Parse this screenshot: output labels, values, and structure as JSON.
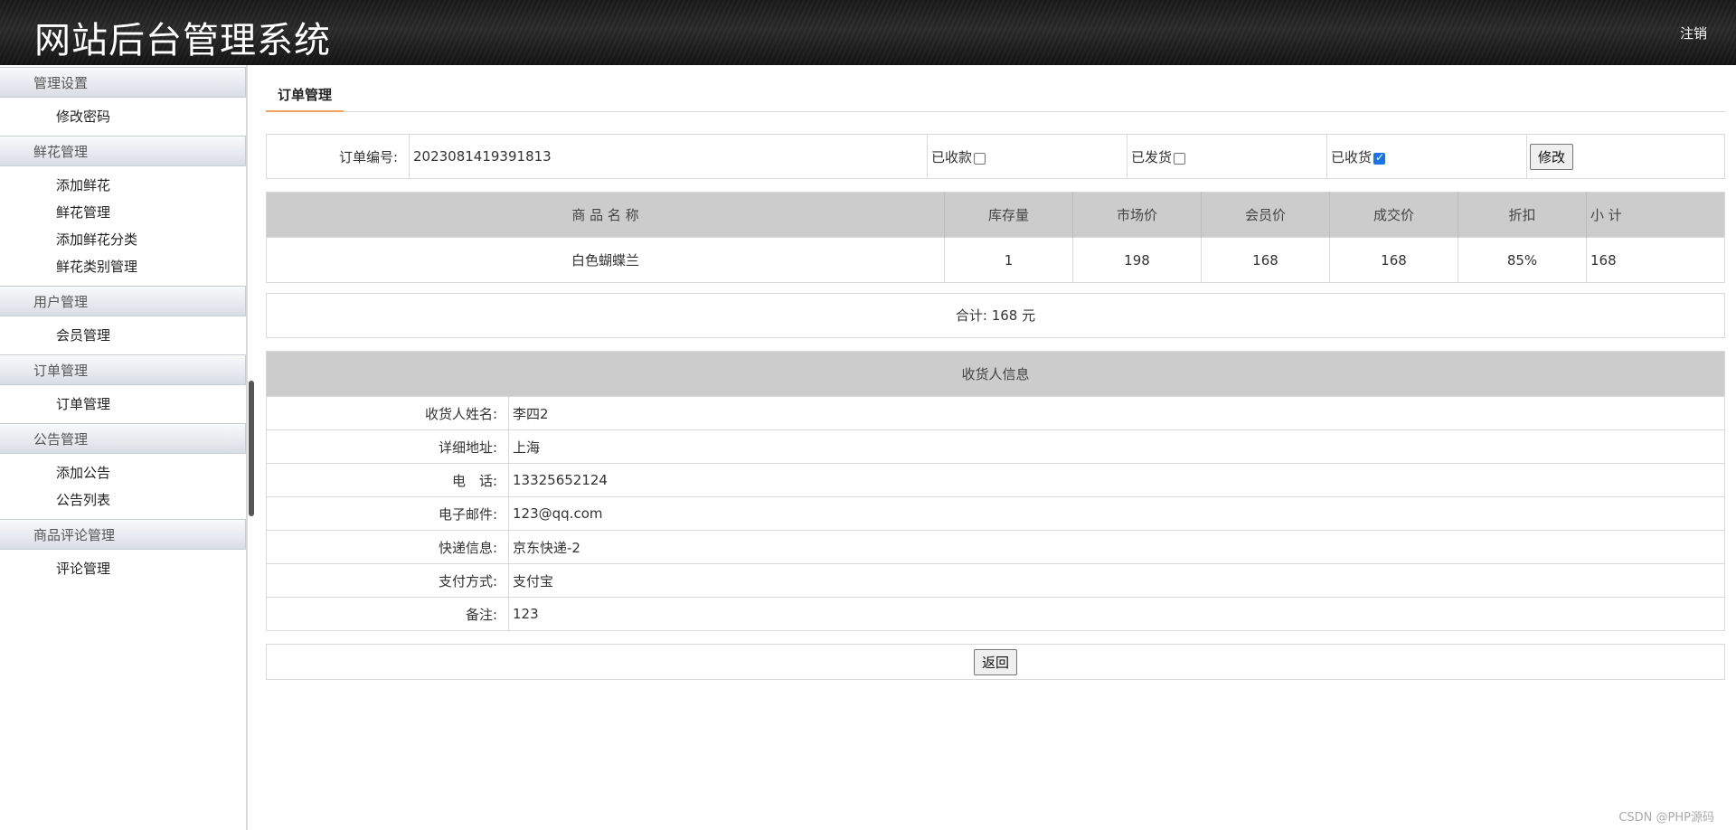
{
  "header": {
    "title": "网站后台管理系统",
    "logout_label": "注销"
  },
  "sidebar": {
    "groups": [
      {
        "label": "管理设置",
        "items": [
          "修改密码"
        ]
      },
      {
        "label": "鲜花管理",
        "items": [
          "添加鲜花",
          "鲜花管理",
          "添加鲜花分类",
          "鲜花类别管理"
        ]
      },
      {
        "label": "用户管理",
        "items": [
          "会员管理"
        ]
      },
      {
        "label": "订单管理",
        "items": [
          "订单管理"
        ]
      },
      {
        "label": "公告管理",
        "items": [
          "添加公告",
          "公告列表"
        ]
      },
      {
        "label": "商品评论管理",
        "items": [
          "评论管理"
        ]
      }
    ]
  },
  "tab": {
    "label": "订单管理"
  },
  "order": {
    "number_label": "订单编号:",
    "number": "2023081419391813",
    "paid_label": "已收款",
    "paid": false,
    "shipped_label": "已发货",
    "shipped": false,
    "received_label": "已收货",
    "received": true,
    "modify_label": "修改"
  },
  "goods": {
    "headers": [
      "商 品 名 称",
      "库存量",
      "市场价",
      "会员价",
      "成交价",
      "折扣",
      "小 计"
    ],
    "rows": [
      [
        "白色蝴蝶兰",
        "1",
        "198",
        "168",
        "168",
        "85%",
        "168"
      ]
    ]
  },
  "total": {
    "text": "合计: 168 元"
  },
  "receiver": {
    "title": "收货人信息",
    "fields": [
      {
        "label": "收货人姓名:",
        "value": "李四2"
      },
      {
        "label": "详细地址:",
        "value": "上海"
      },
      {
        "label": "电　话:",
        "value": "13325652124"
      },
      {
        "label": "电子邮件:",
        "value": "123@qq.com"
      },
      {
        "label": "快递信息:",
        "value": "京东快递-2"
      },
      {
        "label": "支付方式:",
        "value": "支付宝"
      },
      {
        "label": "备注:",
        "value": "123"
      }
    ]
  },
  "back_label": "返回",
  "watermark": "CSDN @PHP源码",
  "colors": {
    "accent": "#f0a060",
    "header_bg": "#1a1a1a",
    "table_head_bg": "#cccccc",
    "checkbox_on": "#1a73e8"
  }
}
